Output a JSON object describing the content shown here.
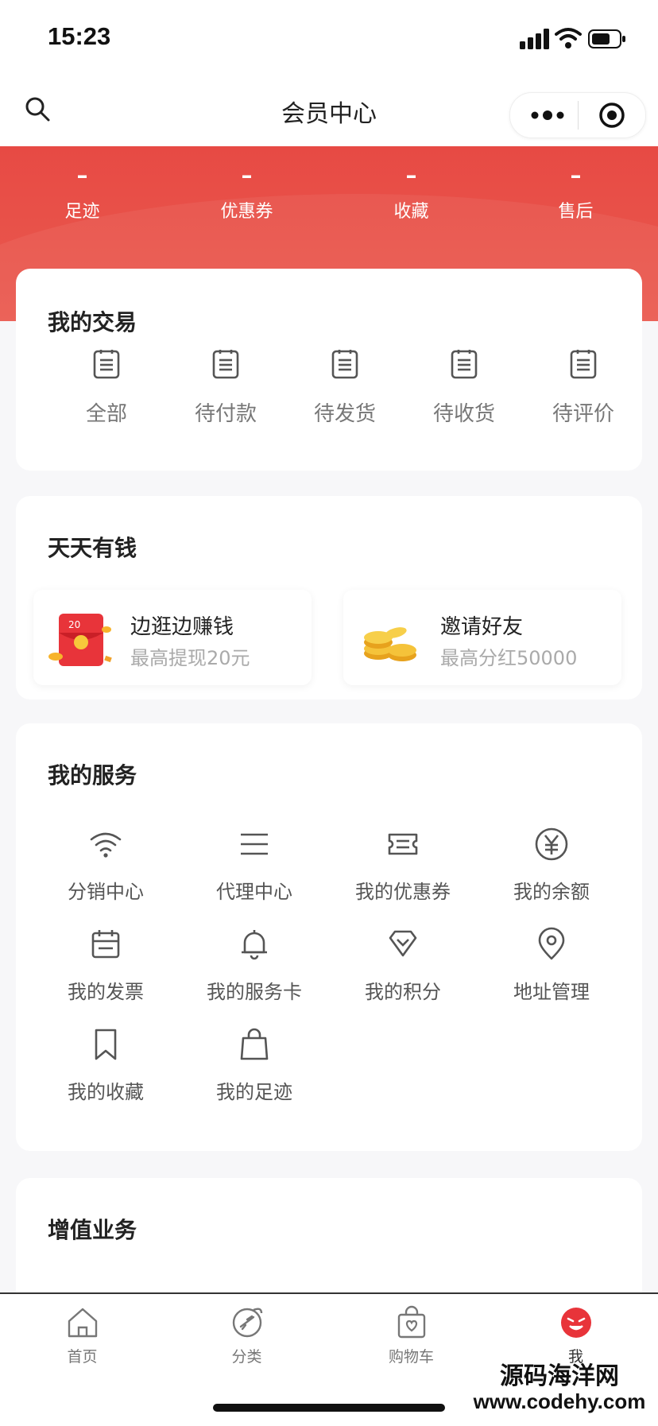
{
  "status_bar": {
    "time": "15:23"
  },
  "nav": {
    "title": "会员中心"
  },
  "stats": [
    {
      "value": "–",
      "label": "足迹"
    },
    {
      "value": "–",
      "label": "优惠券"
    },
    {
      "value": "–",
      "label": "收藏"
    },
    {
      "value": "–",
      "label": "售后"
    }
  ],
  "transactions": {
    "title": "我的交易",
    "items": [
      {
        "label": "全部",
        "icon": "order-list-icon"
      },
      {
        "label": "待付款",
        "icon": "order-list-icon"
      },
      {
        "label": "待发货",
        "icon": "order-list-icon"
      },
      {
        "label": "待收货",
        "icon": "order-list-icon"
      },
      {
        "label": "待评价",
        "icon": "order-list-icon"
      }
    ]
  },
  "daily_money": {
    "title": "天天有钱",
    "items": [
      {
        "title": "边逛边赚钱",
        "subtitle": "最高提现20元",
        "icon": "red-envelope-icon",
        "icon_text": "20"
      },
      {
        "title": "邀请好友",
        "subtitle": "最高分红50000",
        "icon": "gold-coins-icon"
      }
    ]
  },
  "services": {
    "title": "我的服务",
    "items": [
      {
        "label": "分销中心",
        "icon": "wifi-icon"
      },
      {
        "label": "代理中心",
        "icon": "menu-lines-icon"
      },
      {
        "label": "我的优惠券",
        "icon": "ticket-icon"
      },
      {
        "label": "我的余额",
        "icon": "yen-icon"
      },
      {
        "label": "我的发票",
        "icon": "calendar-icon"
      },
      {
        "label": "我的服务卡",
        "icon": "bell-icon"
      },
      {
        "label": "我的积分",
        "icon": "diamond-icon"
      },
      {
        "label": "地址管理",
        "icon": "location-pin-icon"
      },
      {
        "label": "我的收藏",
        "icon": "bookmark-icon"
      },
      {
        "label": "我的足迹",
        "icon": "bag-icon"
      }
    ]
  },
  "value_added": {
    "title": "增值业务"
  },
  "tabbar": [
    {
      "label": "首页",
      "icon": "home-icon"
    },
    {
      "label": "分类",
      "icon": "category-icon"
    },
    {
      "label": "购物车",
      "icon": "cart-bag-icon"
    },
    {
      "label": "我",
      "icon": "me-avatar-icon"
    }
  ],
  "watermark": {
    "line1": "源码海洋网",
    "line2": "www.codehy.com"
  },
  "colors": {
    "accent": "#e74a44"
  }
}
